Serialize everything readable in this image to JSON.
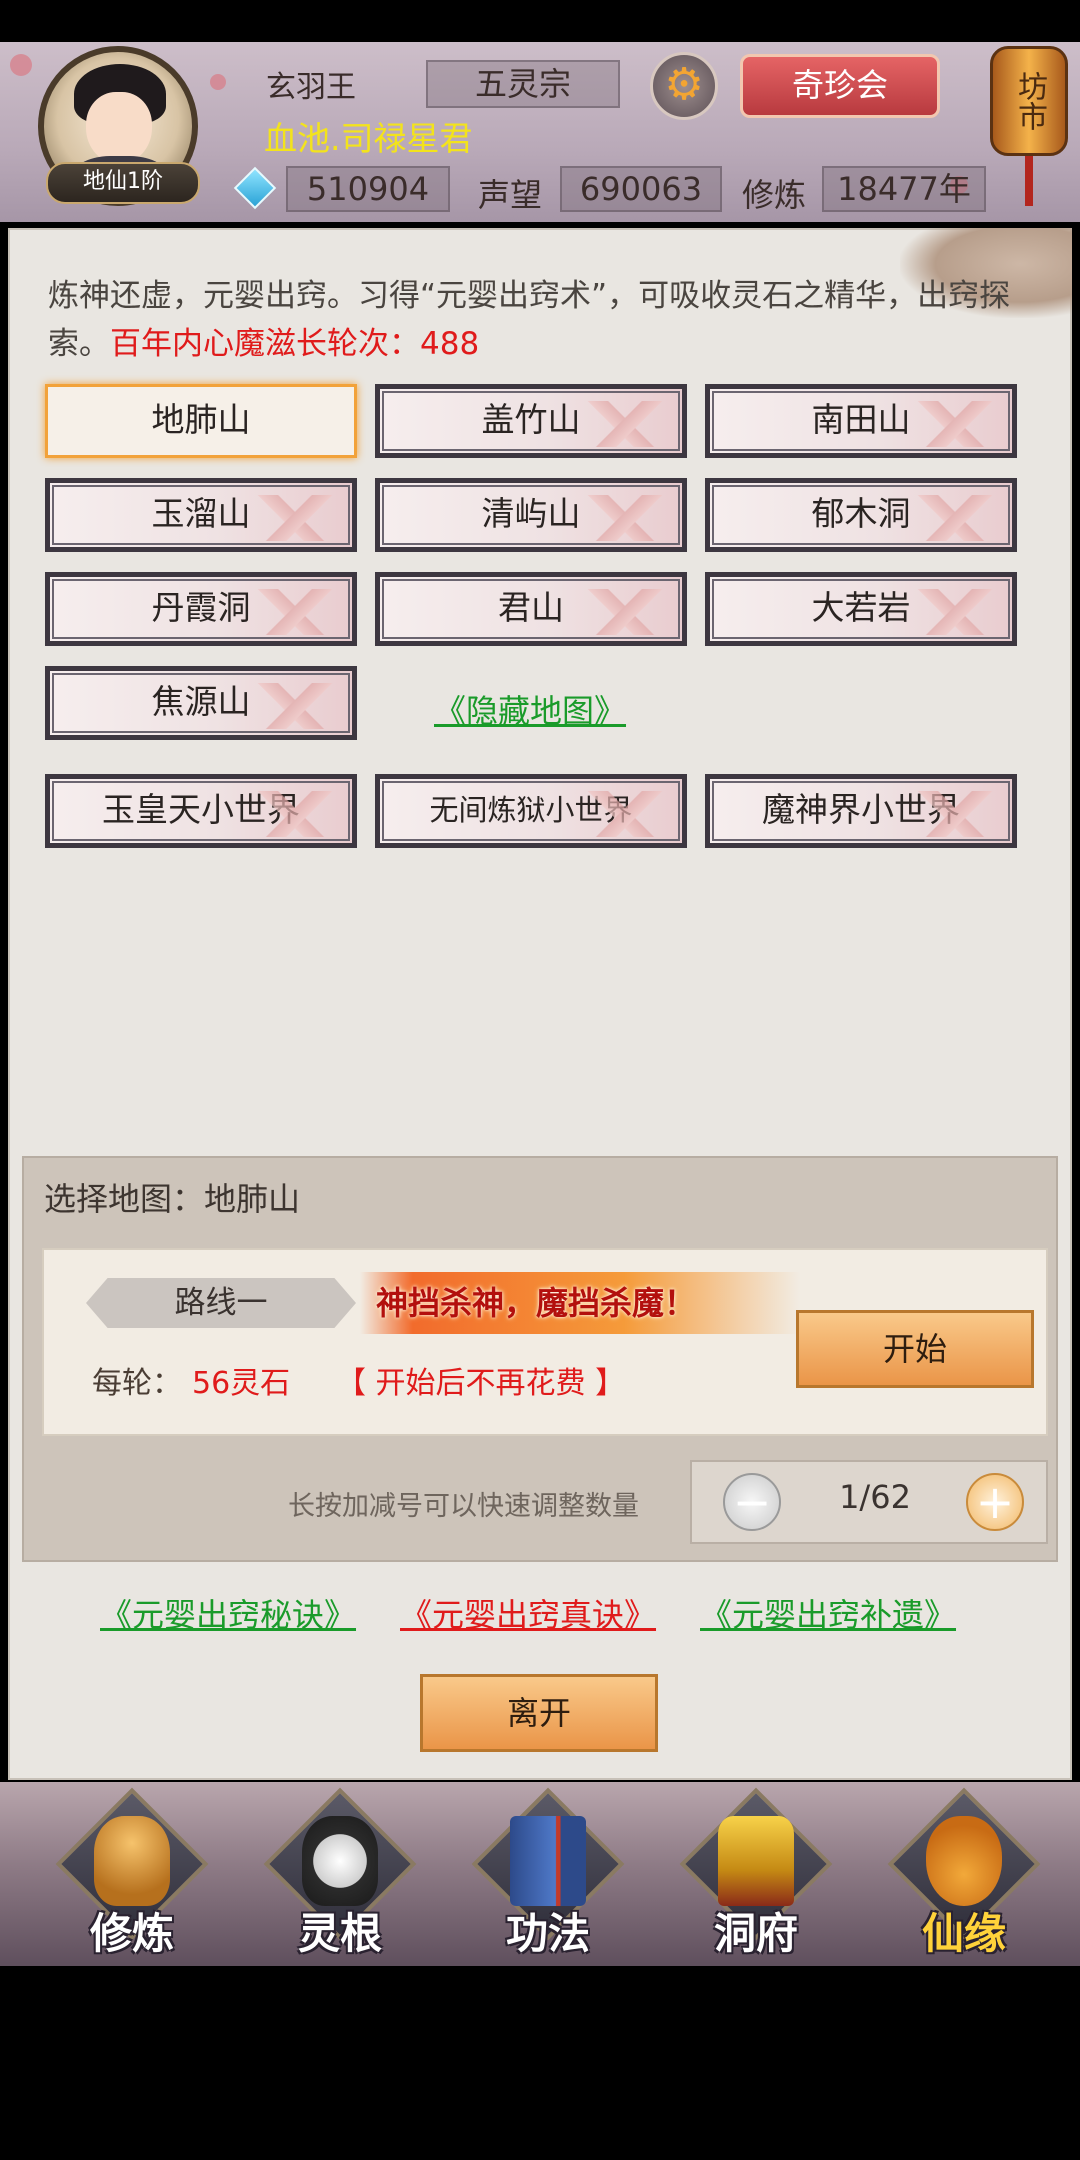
{
  "header": {
    "player_name": "玄羽王",
    "sect": "五灵宗",
    "title": "血池.司禄星君",
    "rank": "地仙1阶",
    "spirit_stones": "510904",
    "reputation_label": "声望",
    "reputation": "690063",
    "cultivation_label": "修炼",
    "cultivation": "18477年",
    "treasure_button": "奇珍会",
    "market_lantern": "坊市"
  },
  "main": {
    "intro_text": "炼神还虚，元婴出窍。习得“元婴出窍术”，可吸收灵石之精华，出窍探索。",
    "intro_highlight": "百年内心魔滋长轮次：488",
    "maps": [
      "地肺山",
      "盖竹山",
      "南田山",
      "玉溜山",
      "清屿山",
      "郁木洞",
      "丹霞洞",
      "君山",
      "大若岩",
      "焦源山"
    ],
    "hidden_map_link": "《隐藏地图》",
    "worlds": [
      "玉皇天小世界",
      "无间炼狱小世界",
      "魔神界小世界"
    ]
  },
  "selection": {
    "title": "选择地图：地肺山",
    "route": "路线一",
    "banner": "神挡杀神，魔挡杀魔！",
    "cost_label": "每轮：",
    "cost_value": "56灵石",
    "cost_note": "【 开始后不再花费 】",
    "start_button": "开始",
    "hint": "长按加减号可以快速调整数量",
    "quantity": "1/62"
  },
  "links": {
    "secret": "《元婴出窍秘诀》",
    "true": "《元婴出窍真诀》",
    "supplement": "《元婴出窍补遗》"
  },
  "leave_button": "离开",
  "nav": [
    {
      "label": "修炼",
      "icon": "monk-icon"
    },
    {
      "label": "灵根",
      "icon": "yin-yang-sword-icon"
    },
    {
      "label": "功法",
      "icon": "book-icon"
    },
    {
      "label": "洞府",
      "icon": "pagoda-icon"
    },
    {
      "label": "仙缘",
      "icon": "gourd-icon"
    }
  ]
}
